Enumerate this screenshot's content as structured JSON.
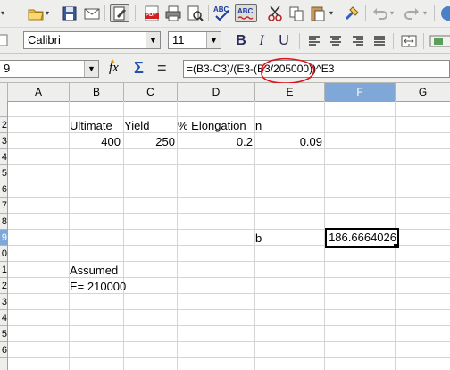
{
  "toolbar": {
    "font_name": "Calibri",
    "font_size": "11",
    "spellcheck_label": "ABC",
    "autospell_label": "ABC",
    "pdf_label": "PDF",
    "bold_label": "B",
    "italic_label": "I",
    "underline_label": "U"
  },
  "formula_bar": {
    "name_box": "9",
    "function_wizard_label": "fx",
    "sum_label": "Σ",
    "equals_label": "=",
    "formula": "=(B3-C3)/(E3-(B3/205000))^E3"
  },
  "columns": [
    "A",
    "B",
    "C",
    "D",
    "E",
    "F",
    "G"
  ],
  "rows": [
    "",
    "2",
    "3",
    "4",
    "5",
    "6",
    "7",
    "8",
    "9",
    "0",
    "1",
    "2",
    "3",
    "4",
    "5",
    "6"
  ],
  "cells": {
    "B2": "Ultimate",
    "C2": "Yield",
    "D2": "% Elongation",
    "E2": "n",
    "B3": "400",
    "C3": "250",
    "D3": "0.2",
    "E3": "0.09",
    "E9": "b",
    "F9": "186.6664026",
    "B11": "Assumed",
    "B12": "E= 210000"
  },
  "colors": {
    "selection_header": "#7fa7d8",
    "annotation_circle": "#e0101a",
    "toolbar_bg": "#eeeeec"
  }
}
